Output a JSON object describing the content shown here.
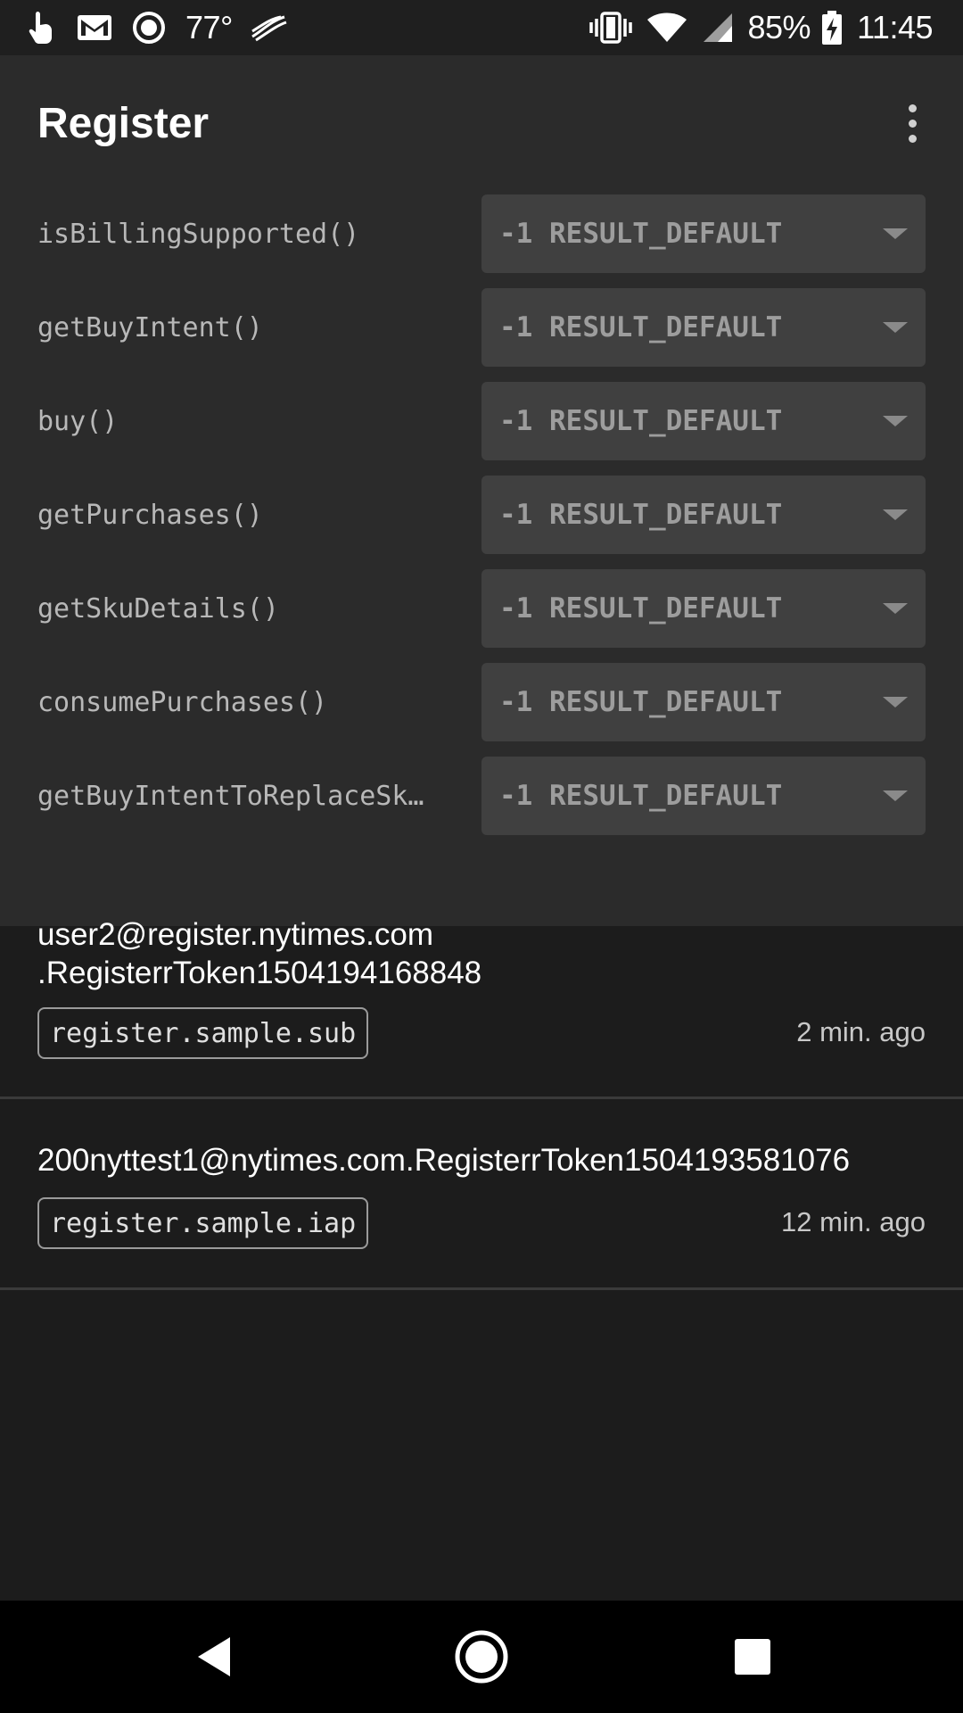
{
  "status_bar": {
    "temperature": "77°",
    "battery": "85%",
    "time": "11:45",
    "icons": [
      "touch-icon",
      "gmail-icon",
      "record-icon",
      "swiftkey-icon",
      "vibrate-icon",
      "wifi-icon",
      "signal-icon",
      "battery-charging-icon"
    ]
  },
  "header": {
    "title": "Register",
    "menu_icon": "more-vert-icon"
  },
  "rows": [
    {
      "label": "isBillingSupported()",
      "value": "-1 RESULT_DEFAULT"
    },
    {
      "label": "getBuyIntent()",
      "value": "-1 RESULT_DEFAULT"
    },
    {
      "label": "buy()",
      "value": "-1 RESULT_DEFAULT"
    },
    {
      "label": "getPurchases()",
      "value": "-1 RESULT_DEFAULT"
    },
    {
      "label": "getSkuDetails()",
      "value": "-1 RESULT_DEFAULT"
    },
    {
      "label": "consumePurchases()",
      "value": "-1 RESULT_DEFAULT"
    },
    {
      "label": "getBuyIntentToReplaceSk…",
      "value": "-1 RESULT_DEFAULT"
    }
  ],
  "purchases": [
    {
      "title": "user2@register.nytimes.com\n.RegisterrToken1504194168848",
      "title_line1": "user2@register.nytimes.com",
      "title_line2": ".RegisterrToken1504194168848",
      "sku": "register.sample.sub",
      "time": "2 min. ago"
    },
    {
      "title": "200nyttest1@nytimes.com.RegisterrToken1504193581076",
      "sku": "register.sample.iap",
      "time": "12 min. ago"
    }
  ],
  "nav_bar": {
    "icons": [
      "back-icon",
      "home-icon",
      "recents-icon"
    ]
  },
  "colors": {
    "background": "#1c1c1c",
    "header_background": "#2b2b2b",
    "dropdown_background": "#404040",
    "divider": "#3a3a3a"
  }
}
